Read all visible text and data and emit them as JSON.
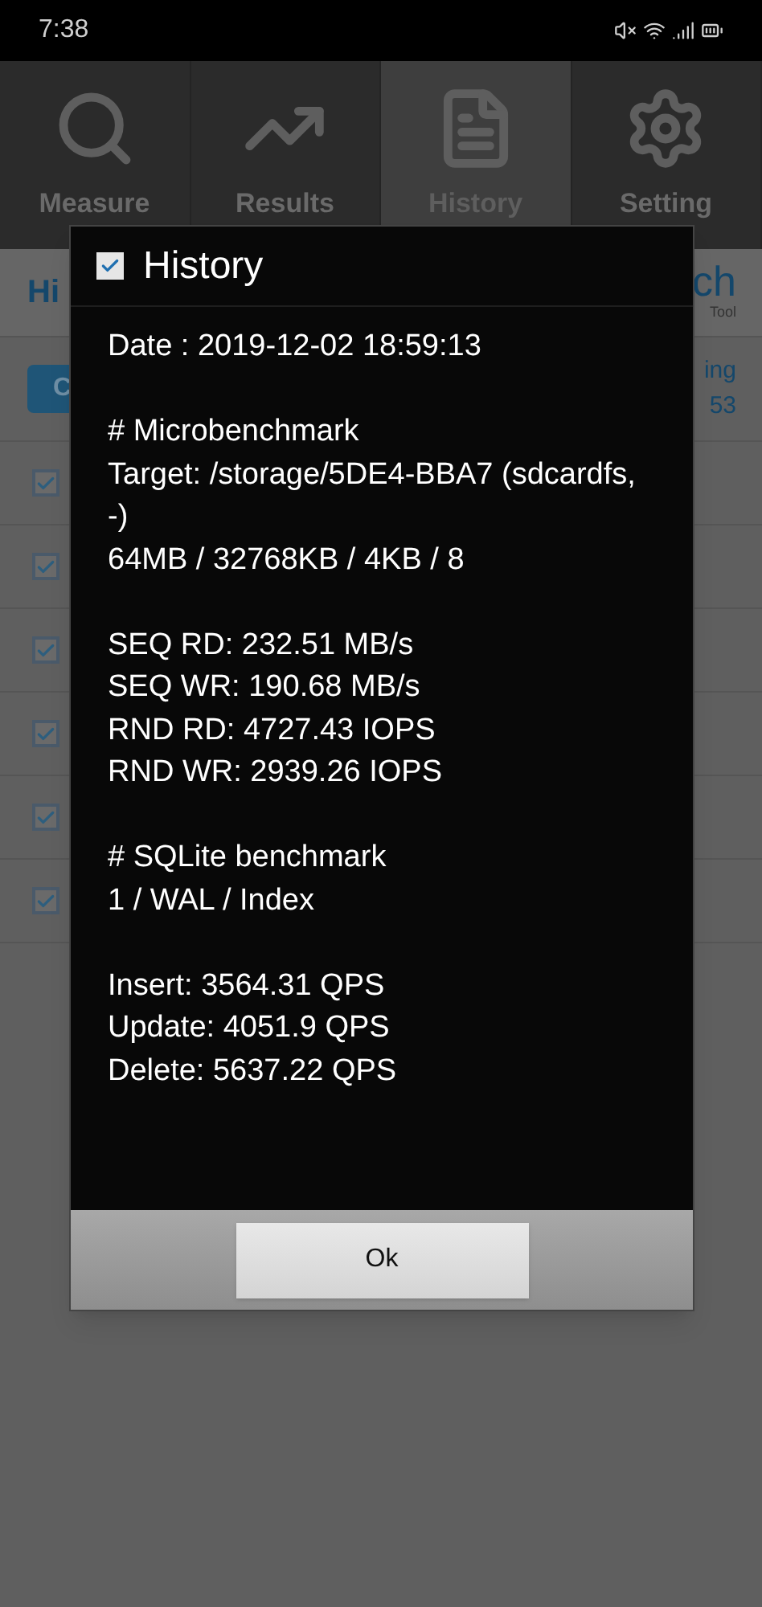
{
  "status_bar": {
    "time": "7:38"
  },
  "tabs": [
    {
      "label": "Measure",
      "selected": false
    },
    {
      "label": "Results",
      "selected": false
    },
    {
      "label": "History",
      "selected": true
    },
    {
      "label": "Setting",
      "selected": false
    }
  ],
  "page": {
    "title_fragment": "Hi",
    "logo_fragment": "ch",
    "logo_tagline_fragment": "Tool",
    "clear_button_fragment": "C",
    "info_fragments": [
      "ing",
      "53"
    ],
    "rows": [
      {
        "checked": true
      },
      {
        "checked": true
      },
      {
        "checked": true
      },
      {
        "checked": true
      },
      {
        "checked": true
      },
      {
        "checked": true
      }
    ]
  },
  "dialog": {
    "title": "History",
    "paragraphs": [
      [
        "Date : 2019-12-02 18:59:13"
      ],
      [
        "# Microbenchmark",
        "Target: /storage/5DE4-BBA7 (sdcardfs, -)",
        "64MB / 32768KB / 4KB / 8"
      ],
      [
        "SEQ RD: 232.51 MB/s",
        "SEQ WR: 190.68 MB/s",
        "RND RD: 4727.43 IOPS",
        "RND WR: 2939.26 IOPS"
      ],
      [
        "# SQLite benchmark",
        "1 / WAL / Index"
      ],
      [
        "Insert: 3564.31 QPS",
        "Update: 4051.9 QPS",
        "Delete: 5637.22 QPS"
      ]
    ],
    "button": "Ok"
  }
}
